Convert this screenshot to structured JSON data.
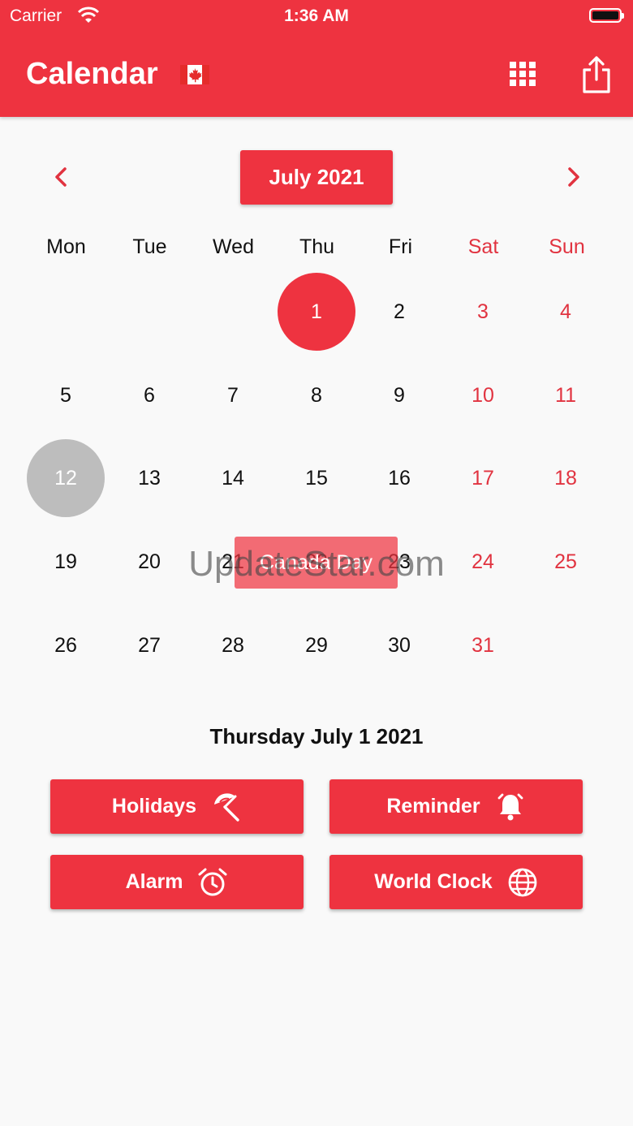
{
  "status_bar": {
    "carrier": "Carrier",
    "time": "1:36 AM"
  },
  "app_bar": {
    "title": "Calendar",
    "flag_icon": "canada-flag-icon",
    "accent_color": "#ee3340"
  },
  "month_nav": {
    "month_label": "July 2021",
    "prev_icon": "chevron-left-icon",
    "next_icon": "chevron-right-icon"
  },
  "weekdays": [
    "Mon",
    "Tue",
    "Wed",
    "Thu",
    "Fri",
    "Sat",
    "Sun"
  ],
  "weeks": [
    [
      "",
      "",
      "",
      "1",
      "2",
      "3",
      "4"
    ],
    [
      "5",
      "6",
      "7",
      "8",
      "9",
      "10",
      "11"
    ],
    [
      "12",
      "13",
      "14",
      "15",
      "16",
      "17",
      "18"
    ],
    [
      "19",
      "20",
      "21",
      "22",
      "23",
      "24",
      "25"
    ],
    [
      "26",
      "27",
      "28",
      "29",
      "30",
      "31",
      ""
    ]
  ],
  "selected_day": "1",
  "today": "12",
  "event": {
    "label": "Canada Day"
  },
  "watermark": "UpdateStar.com",
  "selected_date_text": "Thursday July 1 2021",
  "actions": {
    "holidays": "Holidays",
    "reminder": "Reminder",
    "alarm": "Alarm",
    "world_clock": "World Clock"
  },
  "colors": {
    "weekend_text": "#e13340",
    "today_circle": "#bdbdbd"
  }
}
